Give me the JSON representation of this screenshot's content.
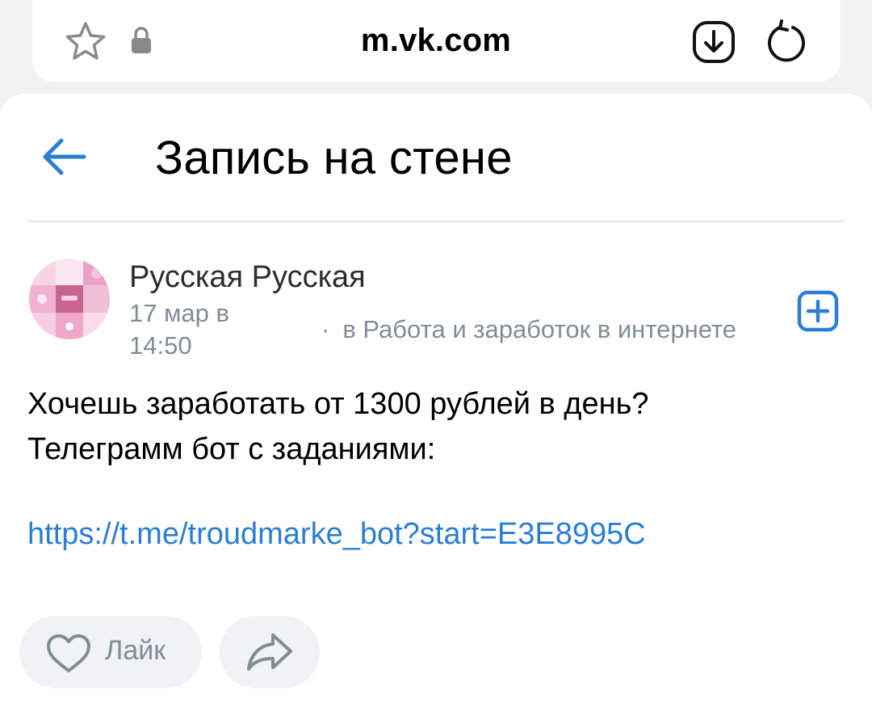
{
  "browser": {
    "url": "m.vk.com"
  },
  "header": {
    "title": "Запись на стене"
  },
  "post": {
    "author": "Русская Русская",
    "date": "17 мар в 14:50",
    "source_prefix": "·",
    "source": "в Работа и заработок в интернете",
    "text_line1": "Хочешь заработать от 1300 рублей в день?",
    "text_line2": "Телеграмм бот с заданиями:",
    "link": "https://t.me/troudmarke_bot?start=E3E8995C"
  },
  "actions": {
    "like_label": "Лайк"
  },
  "colors": {
    "accent": "#2a7fd4",
    "link": "#2a7fd4",
    "muted_text": "#818c99",
    "button_bg": "#f0f2f5"
  },
  "icons": [
    "star-icon",
    "lock-icon",
    "download-icon",
    "reload-icon",
    "back-arrow-icon",
    "subscribe-plus-icon",
    "heart-icon",
    "share-icon"
  ]
}
